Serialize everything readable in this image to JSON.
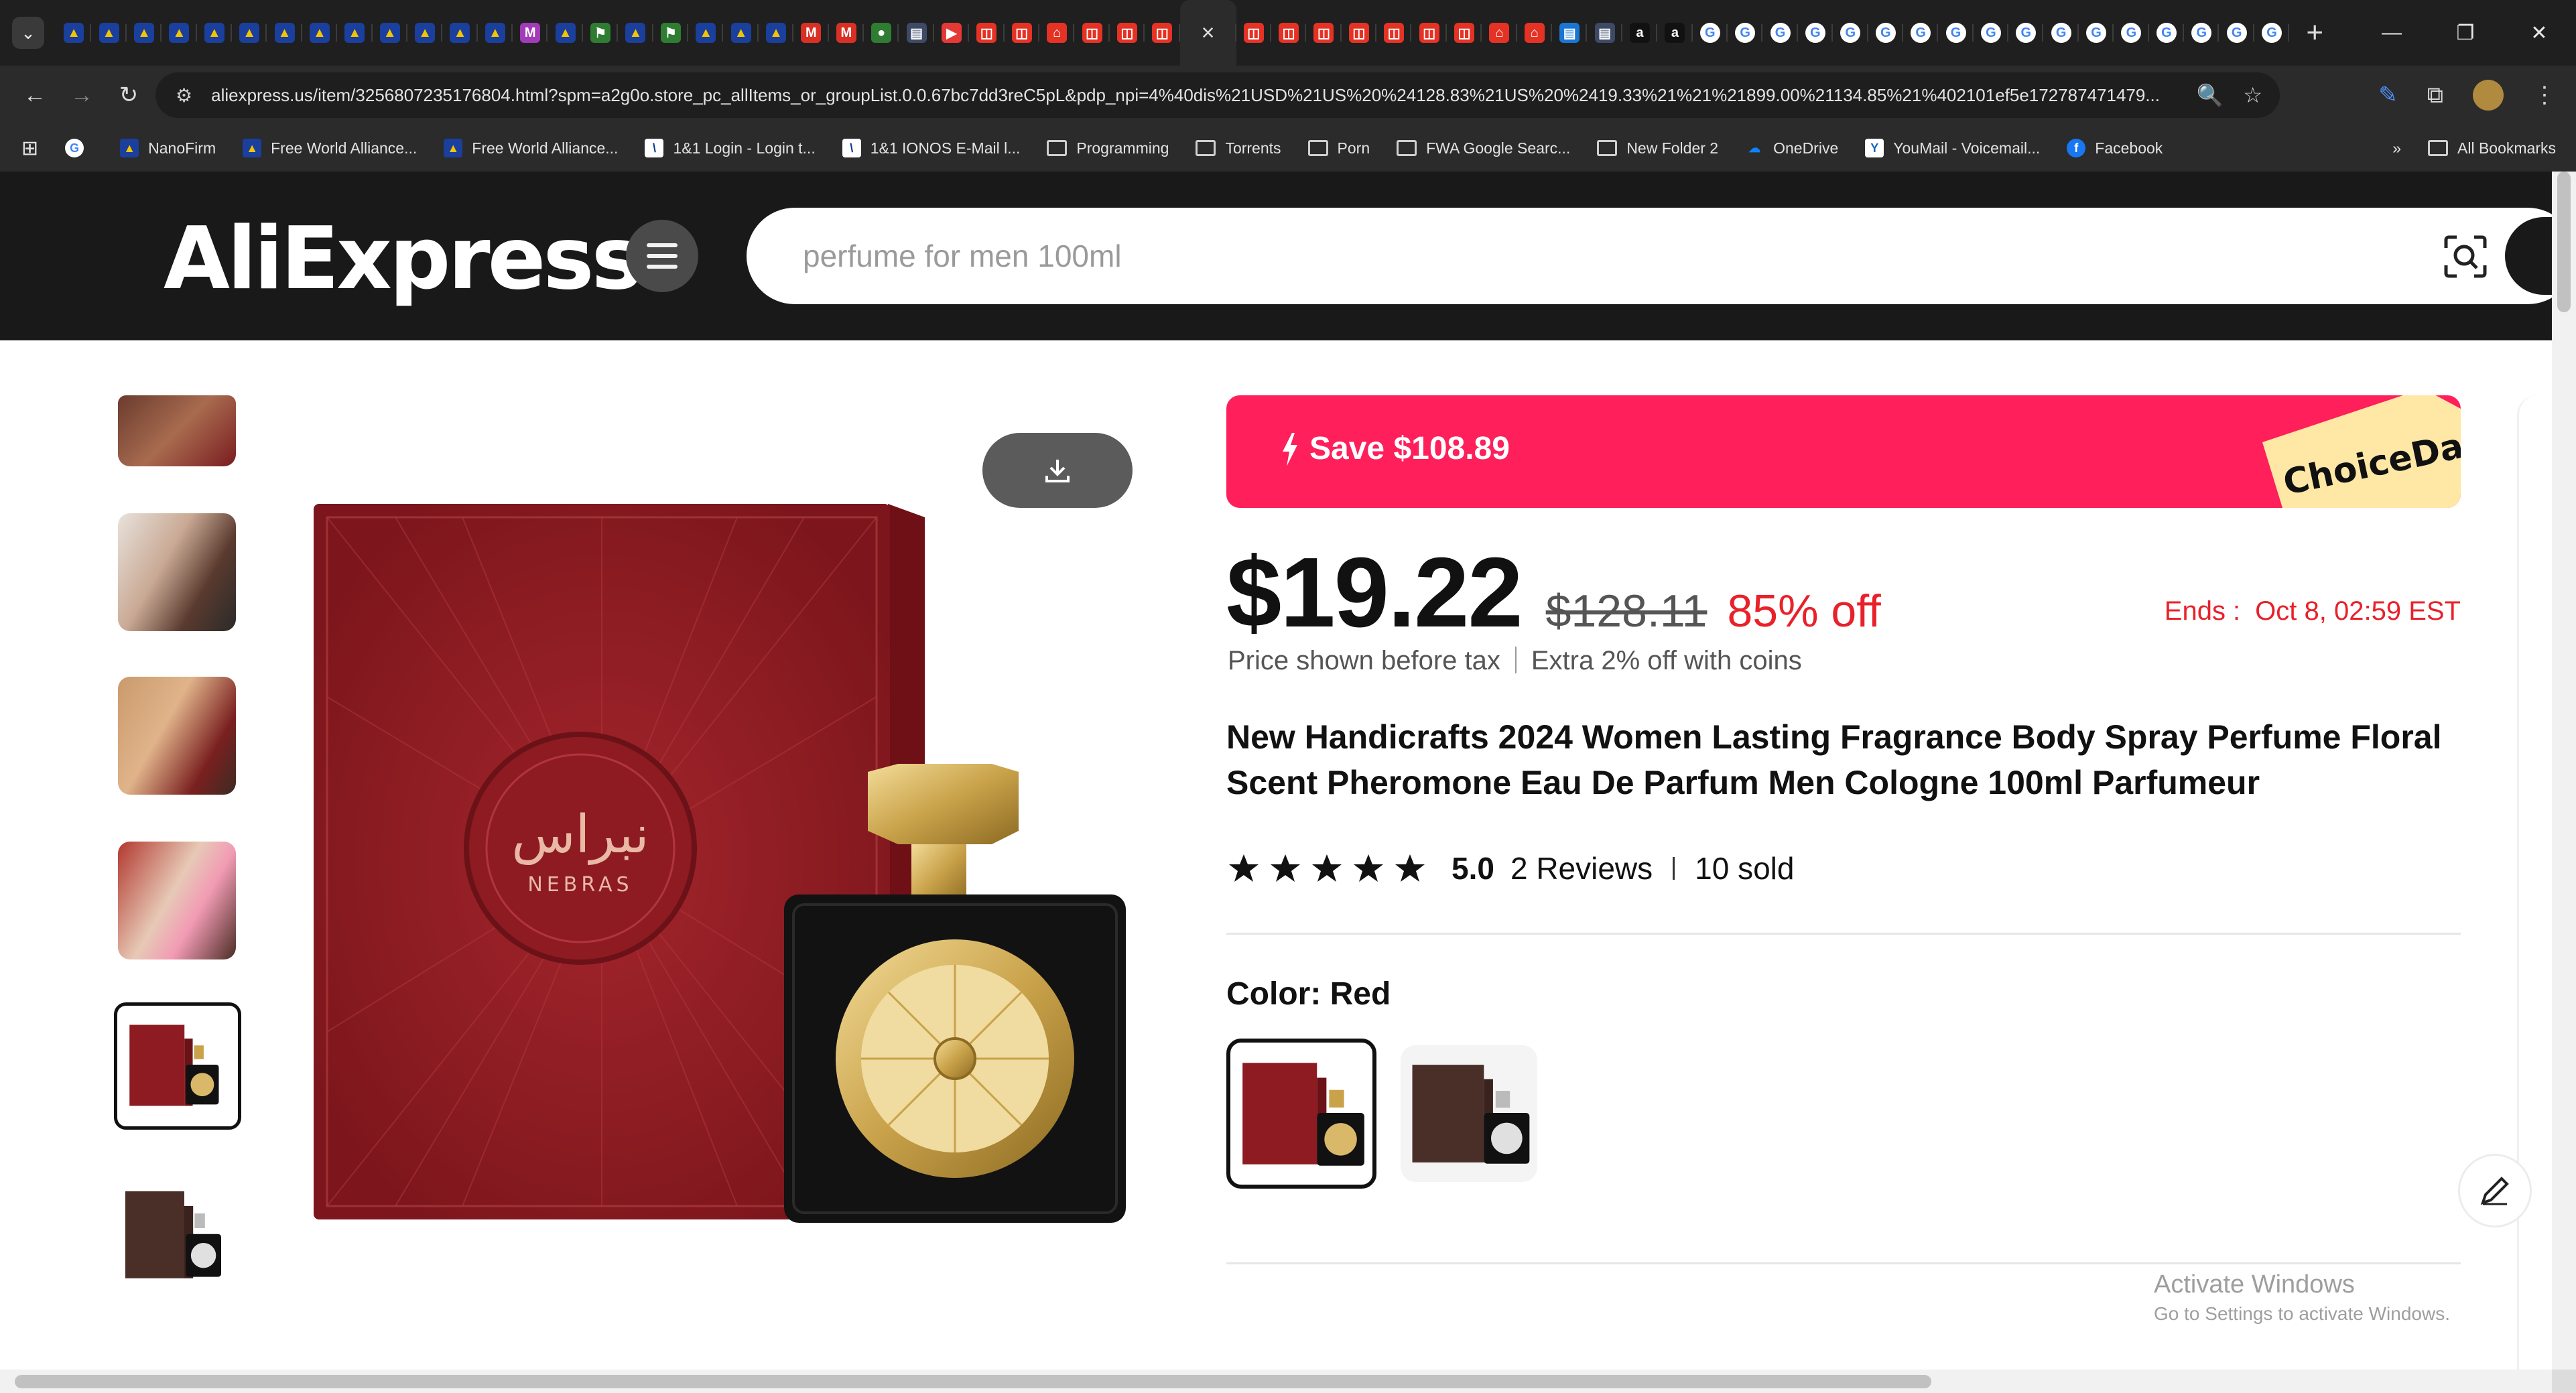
{
  "browser": {
    "tabs": [
      {
        "icon": "fwa",
        "color": "#1a3f9c"
      },
      {
        "icon": "fwa",
        "color": "#1a3f9c"
      },
      {
        "icon": "fwa",
        "color": "#1a3f9c"
      },
      {
        "icon": "fwa",
        "color": "#1a3f9c"
      },
      {
        "icon": "fwa",
        "color": "#1a3f9c"
      },
      {
        "icon": "fwa",
        "color": "#1a3f9c"
      },
      {
        "icon": "fwa",
        "color": "#1a3f9c"
      },
      {
        "icon": "fwa",
        "color": "#1a3f9c"
      },
      {
        "icon": "fwa",
        "color": "#1a3f9c"
      },
      {
        "icon": "fwa",
        "color": "#1a3f9c"
      },
      {
        "icon": "fwa",
        "color": "#1a3f9c"
      },
      {
        "icon": "fwa",
        "color": "#1a3f9c"
      },
      {
        "icon": "fwa",
        "color": "#1a3f9c"
      },
      {
        "icon": "mi",
        "color": "#a13bb8"
      },
      {
        "icon": "fwa",
        "color": "#1a3f9c"
      },
      {
        "icon": "flag",
        "color": "#2e7d32"
      },
      {
        "icon": "fwa",
        "color": "#1a3f9c"
      },
      {
        "icon": "flag",
        "color": "#2e7d32"
      },
      {
        "icon": "fwa",
        "color": "#1a3f9c"
      },
      {
        "icon": "fwa",
        "color": "#1a3f9c"
      },
      {
        "icon": "fwa",
        "color": "#1a3f9c"
      },
      {
        "icon": "gmail",
        "color": "#d93025"
      },
      {
        "icon": "gmail",
        "color": "#d93025"
      },
      {
        "icon": "apple",
        "color": "#2e7d32"
      },
      {
        "icon": "doc",
        "color": "#3c4a66"
      },
      {
        "icon": "play",
        "color": "#e53935"
      },
      {
        "icon": "ali",
        "color": "#e43225"
      },
      {
        "icon": "ali",
        "color": "#e43225"
      },
      {
        "icon": "cart",
        "color": "#e43225"
      },
      {
        "icon": "ali",
        "color": "#e43225"
      },
      {
        "icon": "ali",
        "color": "#e43225"
      },
      {
        "icon": "ali",
        "color": "#e43225"
      }
    ],
    "active_tab_close": "×",
    "tabs_after": [
      {
        "icon": "ali",
        "color": "#e43225"
      },
      {
        "icon": "ali",
        "color": "#e43225"
      },
      {
        "icon": "ali",
        "color": "#e43225"
      },
      {
        "icon": "ali",
        "color": "#e43225"
      },
      {
        "icon": "ali",
        "color": "#e43225"
      },
      {
        "icon": "ali",
        "color": "#e43225"
      },
      {
        "icon": "ali",
        "color": "#e43225"
      },
      {
        "icon": "cart",
        "color": "#e43225"
      },
      {
        "icon": "cart",
        "color": "#e43225"
      },
      {
        "icon": "doc",
        "color": "#1976d2"
      },
      {
        "icon": "doc",
        "color": "#3c4a66"
      },
      {
        "icon": "amazon",
        "color": "#111111"
      },
      {
        "icon": "amazon",
        "color": "#111111"
      },
      {
        "icon": "google",
        "color": "#ffffff"
      },
      {
        "icon": "google",
        "color": "#ffffff"
      },
      {
        "icon": "google",
        "color": "#ffffff"
      },
      {
        "icon": "google",
        "color": "#ffffff"
      },
      {
        "icon": "google",
        "color": "#ffffff"
      },
      {
        "icon": "google",
        "color": "#ffffff"
      },
      {
        "icon": "google",
        "color": "#ffffff"
      },
      {
        "icon": "google",
        "color": "#ffffff"
      },
      {
        "icon": "google",
        "color": "#ffffff"
      },
      {
        "icon": "google",
        "color": "#ffffff"
      },
      {
        "icon": "google",
        "color": "#ffffff"
      },
      {
        "icon": "google",
        "color": "#ffffff"
      },
      {
        "icon": "google",
        "color": "#ffffff"
      },
      {
        "icon": "google",
        "color": "#ffffff"
      },
      {
        "icon": "google",
        "color": "#ffffff"
      },
      {
        "icon": "google",
        "color": "#ffffff"
      },
      {
        "icon": "google",
        "color": "#ffffff"
      }
    ],
    "new_tab": "+",
    "url": "aliexpress.us/item/3256807235176804.html?spm=a2g0o.store_pc_allItems_or_groupList.0.0.67bc7dd3reC5pL&pdp_npi=4%40dis%21USD%21US%20%24128.83%21US%20%2419.33%21%21%21899.00%21134.85%21%402101ef5e172787471479...",
    "bookmarks": [
      {
        "label": "NanoFirm",
        "icon": "fwa"
      },
      {
        "label": "Free World Alliance...",
        "icon": "fwa"
      },
      {
        "label": "Free World Alliance...",
        "icon": "fwa"
      },
      {
        "label": "1&1 Login - Login t...",
        "icon": "ionos"
      },
      {
        "label": "1&1 IONOS E-Mail l...",
        "icon": "ionos"
      },
      {
        "label": "Programming",
        "icon": "folder"
      },
      {
        "label": "Torrents",
        "icon": "folder"
      },
      {
        "label": "Porn",
        "icon": "folder"
      },
      {
        "label": "FWA Google Searc...",
        "icon": "folder"
      },
      {
        "label": "New Folder 2",
        "icon": "folder"
      },
      {
        "label": "OneDrive",
        "icon": "onedrive"
      },
      {
        "label": "YouMail - Voicemail...",
        "icon": "youmail"
      },
      {
        "label": "Facebook",
        "icon": "facebook"
      }
    ],
    "bookmarks_overflow": "»",
    "all_bookmarks": "All Bookmarks"
  },
  "header": {
    "logo_text": "AliExpress",
    "search_placeholder": "perfume for men 100ml"
  },
  "product": {
    "save_banner": "Save $108.89",
    "choice_tag": "ChoiceDay",
    "price": "$19.22",
    "original_price": "$128.11",
    "discount": "85% off",
    "ends_label": "Ends :",
    "ends_time": "Oct 8, 02:59 EST",
    "tax_note": "Price shown before tax",
    "coins_note": "Extra 2% off with coins",
    "title": "New Handicrafts 2024 Women Lasting Fragrance Body Spray Perfume Floral Scent Pheromone Eau De Parfum Men Cologne 100ml Parfumeur",
    "rating": "5.0",
    "stars": 5,
    "reviews": "2 Reviews",
    "sold": "10 sold",
    "color_label": "Color: Red",
    "box_text_arabic": "نبراس",
    "box_text_latin": "NEBRAS",
    "colors": {
      "brand_red": "#fe1f5b",
      "price_red": "#e8212a",
      "box_red": "#8e1b22"
    }
  },
  "system": {
    "activate_title": "Activate Windows",
    "activate_sub": "Go to Settings to activate Windows."
  }
}
